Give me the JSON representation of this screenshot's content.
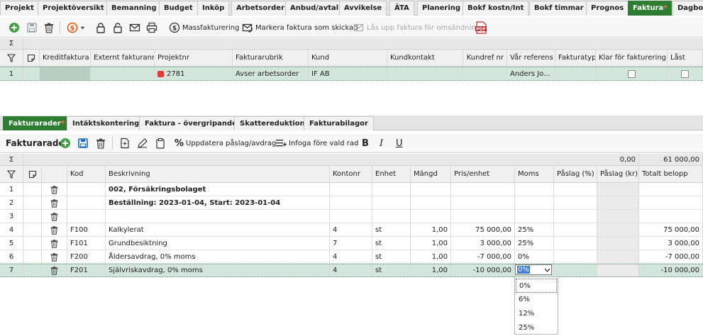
{
  "top_tabs": [
    "Projekt",
    "Projektöversikt",
    "Bemanning",
    "Budget",
    "Inköp",
    "Arbetsorder",
    "Anbud/avtal",
    "Avvikelse",
    "ÄTA",
    "Planering",
    "Bokf kostn/Int",
    "Bokf timmar",
    "Prognos",
    "Faktura",
    "Dagbok"
  ],
  "active_top_tab_marker": "*",
  "toolbar1": {
    "mass_invoicing": "Massfakturering",
    "mark_sent": "Markera faktura som skickad",
    "unlock": "Lås upp faktura för omsändning"
  },
  "invoice_grid": {
    "sigma": "Σ",
    "headers": [
      "Kreditfaktura",
      "Externt fakturanr",
      "Projektnr",
      "Fakturarubrik",
      "Kund",
      "Kundkontakt",
      "Kundref nr",
      "Vår referens",
      "Fakturatyp",
      "Klar för fakturering",
      "Låst"
    ],
    "row": {
      "num": "1",
      "project": "2781",
      "title": "Avser arbetsorder",
      "customer": "IF AB",
      "our_ref": "Anders Jo..."
    }
  },
  "bottom_tabs": [
    "Fakturarader",
    "Intäktskontering",
    "Faktura - övergripande",
    "Skattereduktion",
    "Fakturabilagor"
  ],
  "toolbar2": {
    "title": "Fakturarader",
    "update": "Uppdatera påslag/avdrag",
    "insert": "Infoga före vald rad",
    "bold": "B",
    "italic": "I",
    "underline": "U"
  },
  "lines_grid": {
    "sigma": "Σ",
    "sum_paslag_kr": "0,00",
    "sum_total": "61 000,00",
    "headers": [
      "Kod",
      "Beskrivning",
      "Kontonr",
      "Enhet",
      "Mängd",
      "Pris/enhet",
      "Moms",
      "Påslag (%)",
      "Påslag (kr)",
      "Totalt belopp"
    ],
    "rows": [
      {
        "num": "1",
        "code": "",
        "desc": "002, Försäkringsbolaget",
        "acct": "",
        "unit": "",
        "qty": "",
        "price": "",
        "vat": "",
        "total": "",
        "bold": true
      },
      {
        "num": "2",
        "code": "",
        "desc": "Beställning: 2023-01-04, Start: 2023-01-04",
        "acct": "",
        "unit": "",
        "qty": "",
        "price": "",
        "vat": "",
        "total": "",
        "bold": true
      },
      {
        "num": "3",
        "code": "",
        "desc": "",
        "acct": "",
        "unit": "",
        "qty": "",
        "price": "",
        "vat": "",
        "total": ""
      },
      {
        "num": "4",
        "code": "F100",
        "desc": "Kalkylerat",
        "acct": "4",
        "unit": "st",
        "qty": "1,00",
        "price": "75 000,00",
        "vat": "25%",
        "total": "75 000,00"
      },
      {
        "num": "5",
        "code": "F101",
        "desc": "Grundbesiktning",
        "acct": "7",
        "unit": "st",
        "qty": "1,00",
        "price": "3 000,00",
        "vat": "25%",
        "total": "3 000,00"
      },
      {
        "num": "6",
        "code": "F200",
        "desc": "Åldersavdrag, 0% moms",
        "acct": "4",
        "unit": "st",
        "qty": "1,00",
        "price": "-7 000,00",
        "vat": "0%",
        "total": "-7 000,00"
      },
      {
        "num": "7",
        "code": "F201",
        "desc": "Självriskavdrag, 0% moms",
        "acct": "4",
        "unit": "st",
        "qty": "1,00",
        "price": "-10 000,00",
        "vat": "0%",
        "total": "-10 000,00"
      }
    ]
  },
  "moms_dropdown": {
    "value": "0%",
    "options": [
      "0%",
      "6%",
      "12%",
      "25%"
    ]
  },
  "colors": {
    "active_tab": "#2e7d32",
    "tab_marker": "#ff7043",
    "selected_row": "#d3e6dc",
    "add_icon": "#43a047",
    "project_dot": "#e53935",
    "save_icon": "#1565c0"
  }
}
